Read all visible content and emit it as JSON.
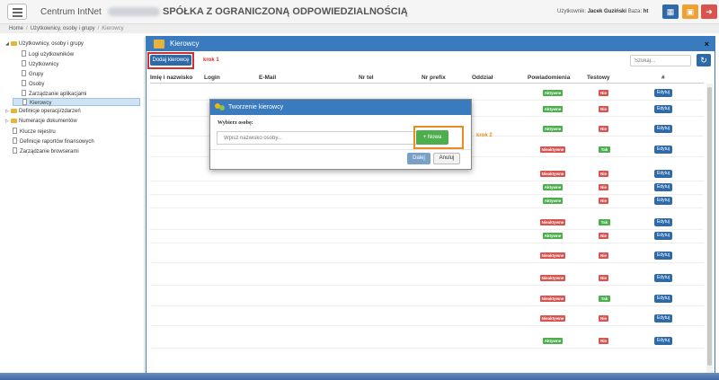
{
  "header": {
    "app_name": "Centrum IntNet",
    "company": "SPÓŁKA Z OGRANICZONĄ ODPOWIEDZIALNOŚCIĄ",
    "user_label": "Użytkownik:",
    "user_name": "Jacek Guziński",
    "base_label": "Baza:",
    "base_value": "ht"
  },
  "breadcrumb": [
    "Home",
    "Użytkownicy, osoby i grupy",
    "Kierowcy"
  ],
  "sidebar": {
    "root_label": "Użytkownicy, osoby i grupy",
    "children": [
      "Logi użytkowników",
      "Użytkownicy",
      "Grupy",
      "Osoby",
      "Zarządzanie aplikacjami",
      "Kierowcy"
    ],
    "folders": [
      "Definicje operacji/zdarzeń",
      "Numeracje dokumentów"
    ],
    "items": [
      "Klucze rejestru",
      "Definicje raportów finansowych",
      "Zarządzanie browserami"
    ]
  },
  "panel": {
    "title": "Kierowcy",
    "close_symbol": "×",
    "add_button": "Dodaj kierowcę",
    "step1": "krok 1",
    "search_placeholder": "Szukaj...",
    "columns": [
      "Imię i nazwisko",
      "Login",
      "E-Mail",
      "Nr tel",
      "Nr prefix",
      "Oddział",
      "Powiadomienia",
      "Testowy",
      "#"
    ],
    "rows": [
      {
        "notify": "Aktywne",
        "test": "Nie",
        "edit": "Edytuj"
      },
      {
        "notify": "Aktywne",
        "test": "Nie",
        "edit": "Edytuj"
      },
      {
        "notify": "Aktywne",
        "test": "Nie",
        "edit": "Edytuj"
      },
      {
        "notify": "Nieaktywne",
        "test": "Tak",
        "edit": "Edytuj"
      },
      {
        "notify": "Nieaktywne",
        "test": "Nie",
        "edit": "Edytuj"
      },
      {
        "notify": "Aktywne",
        "test": "Nie",
        "edit": "Edytuj"
      },
      {
        "notify": "Aktywne",
        "test": "Nie",
        "edit": "Edytuj"
      },
      {
        "notify": "Nieaktywne",
        "test": "Tak",
        "edit": "Edytuj"
      },
      {
        "notify": "Aktywne",
        "test": "Nie",
        "edit": "Edytuj"
      },
      {
        "notify": "Nieaktywne",
        "test": "Nie",
        "edit": "Edytuj"
      },
      {
        "notify": "Nieaktywne",
        "test": "Nie",
        "edit": "Edytuj"
      },
      {
        "notify": "Nieaktywne",
        "test": "Tak",
        "edit": "Edytuj"
      },
      {
        "notify": "Nieaktywne",
        "test": "Nie",
        "edit": "Edytuj"
      },
      {
        "notify": "Aktywne",
        "test": "Nie",
        "edit": "Edytuj"
      }
    ]
  },
  "modal": {
    "title": "Tworzenie kierowcy",
    "label": "Wybierz osobę:",
    "input_placeholder": "Wpisz nazwisko osoby...",
    "new_button": "+ Nowa",
    "step2": "krok 2",
    "next_button": "Dalej",
    "cancel_button": "Anuluj"
  },
  "colors": {
    "primary": "#3a7abf",
    "active_badge": "#4cae4c",
    "inactive_badge": "#d9534f",
    "step1_highlight": "#d32f2f",
    "step2_highlight": "#ee8a22"
  }
}
